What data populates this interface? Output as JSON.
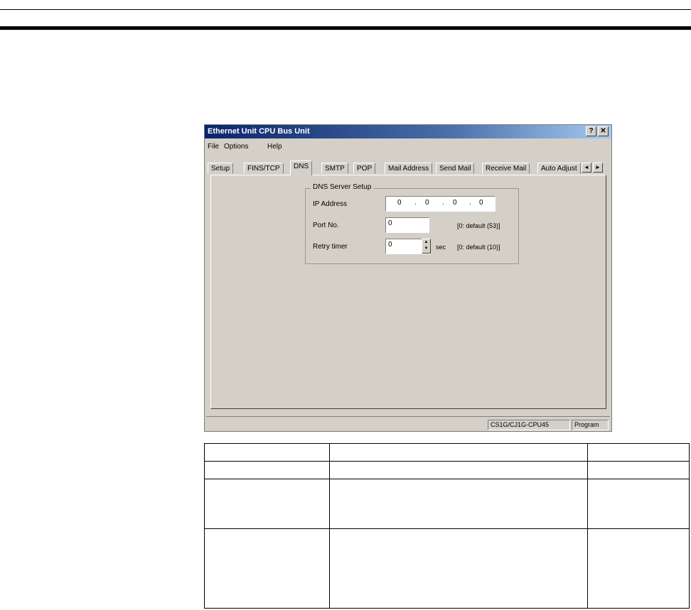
{
  "window": {
    "title": "Ethernet Unit CPU Bus Unit",
    "help_button": "?",
    "close_button": "✕"
  },
  "menu": [
    "File",
    "Options",
    "Help"
  ],
  "tabs": [
    "Setup",
    "FINS/TCP",
    "DNS",
    "SMTP",
    "POP",
    "Mail Address",
    "Send Mail",
    "Receive Mail",
    "Auto Adjust"
  ],
  "active_tab": "DNS",
  "tab_scroll": {
    "left": "◄",
    "right": "►"
  },
  "dns_setup": {
    "group_title": "DNS Server Setup",
    "ip_label": "IP Address",
    "ip_octets": [
      "0",
      "0",
      "0",
      "0"
    ],
    "port_label": "Port No.",
    "port_value": "0",
    "port_hint": "[0: default (53)]",
    "retry_label": "Retry timer",
    "retry_value": "0",
    "retry_unit": "sec",
    "retry_hint": "[0: default (10)]"
  },
  "status": {
    "model": "CS1G/CJ1G-CPU45",
    "mode": "Program"
  }
}
